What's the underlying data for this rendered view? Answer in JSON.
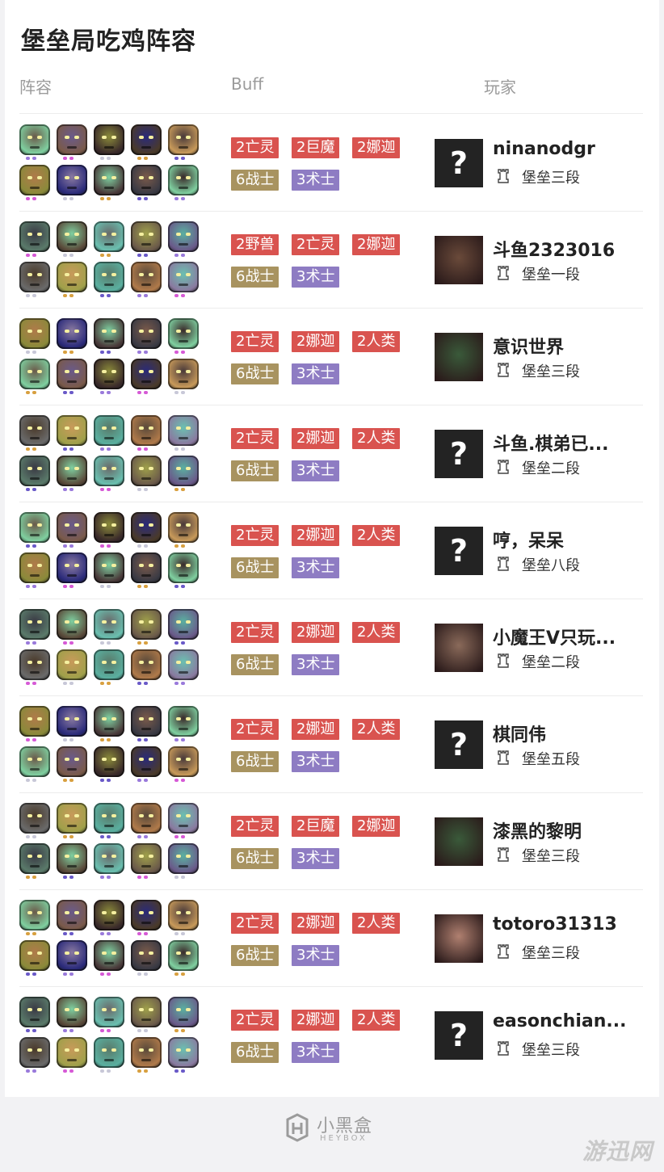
{
  "title": "堡垒局吃鸡阵容",
  "headers": {
    "lineup": "阵容",
    "buff": "Buff",
    "player": "玩家"
  },
  "colors": {
    "tag_red": "#d9534f",
    "tag_gold": "#a89360",
    "tag_purple": "#8e7cc3",
    "avatar_bg": "#232323"
  },
  "rows": [
    {
      "buffs_top": [
        "2亡灵",
        "2巨魔",
        "2娜迦"
      ],
      "buffs_bottom": [
        "6战士",
        "3术士"
      ],
      "avatar": "?",
      "player": "ninanodgr",
      "rank": "堡垒三段"
    },
    {
      "buffs_top": [
        "2野兽",
        "2亡灵",
        "2娜迦"
      ],
      "buffs_bottom": [
        "6战士",
        "3术士"
      ],
      "avatar": "",
      "player": "斗鱼2323016",
      "rank": "堡垒一段"
    },
    {
      "buffs_top": [
        "2亡灵",
        "2娜迦",
        "2人类"
      ],
      "buffs_bottom": [
        "6战士",
        "3术士"
      ],
      "avatar": "",
      "player": "意识世界",
      "rank": "堡垒三段"
    },
    {
      "buffs_top": [
        "2亡灵",
        "2娜迦",
        "2人类"
      ],
      "buffs_bottom": [
        "6战士",
        "3术士"
      ],
      "avatar": "?",
      "player": "斗鱼.棋弟已...",
      "rank": "堡垒二段"
    },
    {
      "buffs_top": [
        "2亡灵",
        "2娜迦",
        "2人类"
      ],
      "buffs_bottom": [
        "6战士",
        "3术士"
      ],
      "avatar": "?",
      "player": "哼，呆呆",
      "rank": "堡垒八段"
    },
    {
      "buffs_top": [
        "2亡灵",
        "2娜迦",
        "2人类"
      ],
      "buffs_bottom": [
        "6战士",
        "3术士"
      ],
      "avatar": "",
      "player": "小魔王V只玩...",
      "rank": "堡垒二段"
    },
    {
      "buffs_top": [
        "2亡灵",
        "2娜迦",
        "2人类"
      ],
      "buffs_bottom": [
        "6战士",
        "3术士"
      ],
      "avatar": "?",
      "player": "棋同伟",
      "rank": "堡垒五段"
    },
    {
      "buffs_top": [
        "2亡灵",
        "2巨魔",
        "2娜迦"
      ],
      "buffs_bottom": [
        "6战士",
        "3术士"
      ],
      "avatar": "",
      "player": "漆黑的黎明",
      "rank": "堡垒三段"
    },
    {
      "buffs_top": [
        "2亡灵",
        "2娜迦",
        "2人类"
      ],
      "buffs_bottom": [
        "6战士",
        "3术士"
      ],
      "avatar": "",
      "player": "totoro31313",
      "rank": "堡垒三段"
    },
    {
      "buffs_top": [
        "2亡灵",
        "2娜迦",
        "2人类"
      ],
      "buffs_bottom": [
        "6战士",
        "3术士"
      ],
      "avatar": "?",
      "player": "easonchian...",
      "rank": "堡垒三段"
    }
  ],
  "footer": {
    "brand_cn": "小黑盒",
    "brand_en": "HEYBOX"
  },
  "watermark": "游迅网"
}
